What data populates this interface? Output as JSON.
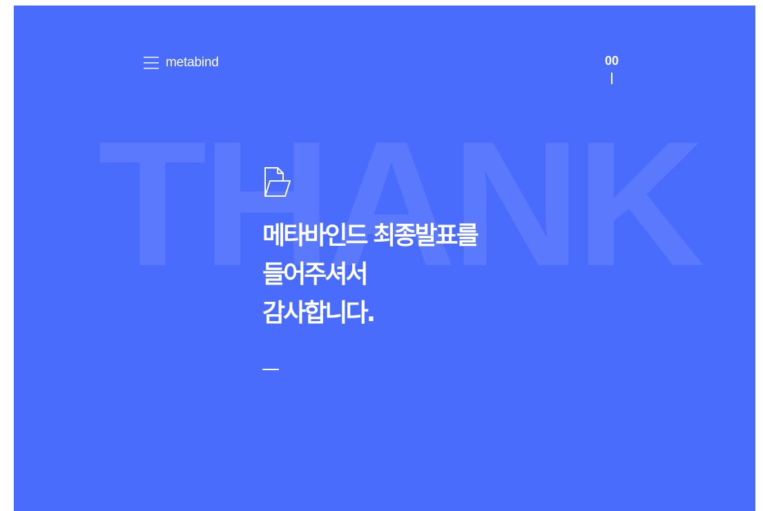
{
  "colors": {
    "background": "#4a6cfd",
    "text": "#ffffff"
  },
  "header": {
    "menu_icon": "hamburger-icon",
    "brand": "metabind",
    "page_number": "00"
  },
  "background_word": "THANK",
  "main": {
    "icon": "folder-open-icon",
    "headline": [
      "메타바인드 최종발표를",
      "들어주셔서",
      "감사합니다."
    ]
  }
}
